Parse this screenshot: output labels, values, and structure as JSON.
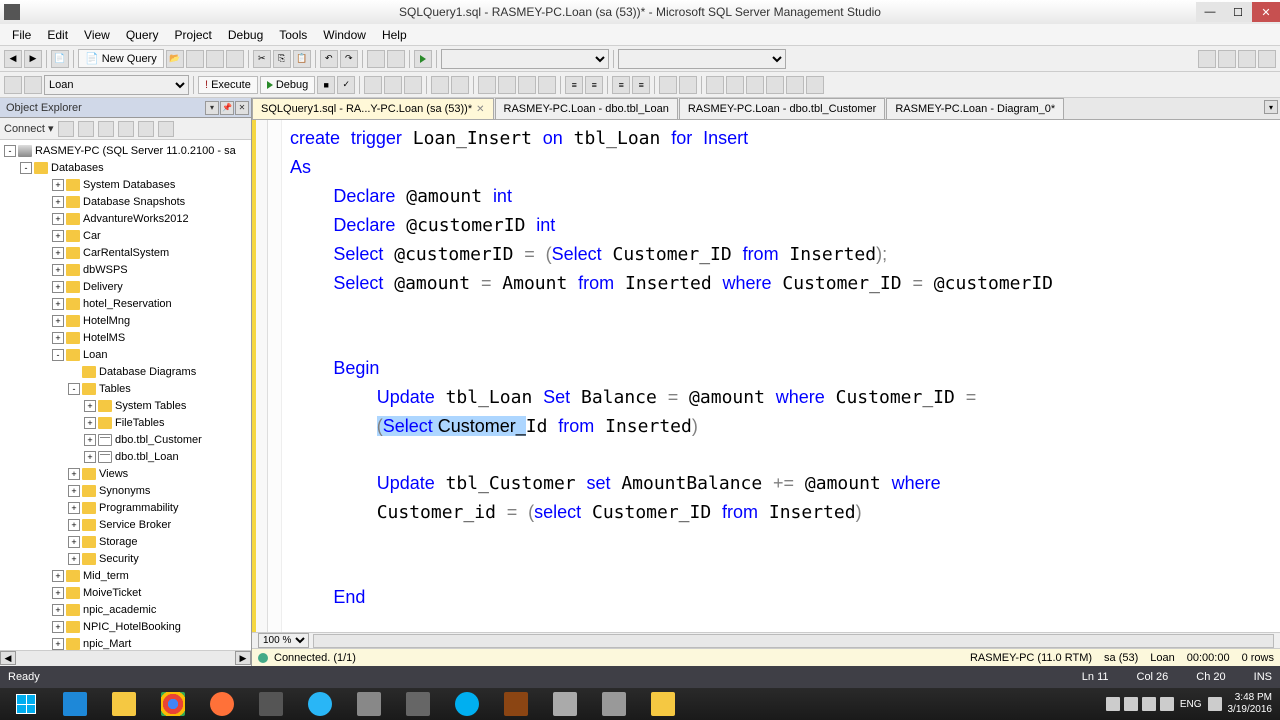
{
  "titlebar": {
    "text": "SQLQuery1.sql - RASMEY-PC.Loan (sa (53))* - Microsoft SQL Server Management Studio"
  },
  "menu": [
    "File",
    "Edit",
    "View",
    "Query",
    "Project",
    "Debug",
    "Tools",
    "Window",
    "Help"
  ],
  "toolbar": {
    "new_query": "New Query",
    "execute": "Execute",
    "debug": "Debug",
    "db_combo": "Loan"
  },
  "object_explorer": {
    "title": "Object Explorer",
    "connect": "Connect ▾",
    "server": "RASMEY-PC (SQL Server 11.0.2100 - sa",
    "databases": "Databases",
    "nodes": [
      {
        "label": "System Databases",
        "type": "folder",
        "exp": "+",
        "indent": 3
      },
      {
        "label": "Database Snapshots",
        "type": "folder",
        "exp": "+",
        "indent": 3
      },
      {
        "label": "AdvantureWorks2012",
        "type": "folder",
        "exp": "+",
        "indent": 3
      },
      {
        "label": "Car",
        "type": "folder",
        "exp": "+",
        "indent": 3
      },
      {
        "label": "CarRentalSystem",
        "type": "folder",
        "exp": "+",
        "indent": 3
      },
      {
        "label": "dbWSPS",
        "type": "folder",
        "exp": "+",
        "indent": 3
      },
      {
        "label": "Delivery",
        "type": "folder",
        "exp": "+",
        "indent": 3
      },
      {
        "label": "hotel_Reservation",
        "type": "folder",
        "exp": "+",
        "indent": 3
      },
      {
        "label": "HotelMng",
        "type": "folder",
        "exp": "+",
        "indent": 3
      },
      {
        "label": "HotelMS",
        "type": "folder",
        "exp": "+",
        "indent": 3
      },
      {
        "label": "Loan",
        "type": "folder",
        "exp": "-",
        "indent": 3
      },
      {
        "label": "Database Diagrams",
        "type": "folder",
        "exp": "",
        "indent": 4
      },
      {
        "label": "Tables",
        "type": "folder",
        "exp": "-",
        "indent": 4
      },
      {
        "label": "System Tables",
        "type": "folder",
        "exp": "+",
        "indent": 5
      },
      {
        "label": "FileTables",
        "type": "folder",
        "exp": "+",
        "indent": 5
      },
      {
        "label": "dbo.tbl_Customer",
        "type": "table",
        "exp": "+",
        "indent": 5
      },
      {
        "label": "dbo.tbl_Loan",
        "type": "table",
        "exp": "+",
        "indent": 5
      },
      {
        "label": "Views",
        "type": "folder",
        "exp": "+",
        "indent": 4
      },
      {
        "label": "Synonyms",
        "type": "folder",
        "exp": "+",
        "indent": 4
      },
      {
        "label": "Programmability",
        "type": "folder",
        "exp": "+",
        "indent": 4
      },
      {
        "label": "Service Broker",
        "type": "folder",
        "exp": "+",
        "indent": 4
      },
      {
        "label": "Storage",
        "type": "folder",
        "exp": "+",
        "indent": 4
      },
      {
        "label": "Security",
        "type": "folder",
        "exp": "+",
        "indent": 4
      },
      {
        "label": "Mid_term",
        "type": "folder",
        "exp": "+",
        "indent": 3
      },
      {
        "label": "MoiveTicket",
        "type": "folder",
        "exp": "+",
        "indent": 3
      },
      {
        "label": "npic_academic",
        "type": "folder",
        "exp": "+",
        "indent": 3
      },
      {
        "label": "NPIC_HotelBooking",
        "type": "folder",
        "exp": "+",
        "indent": 3
      },
      {
        "label": "npic_Mart",
        "type": "folder",
        "exp": "+",
        "indent": 3
      }
    ]
  },
  "tabs": [
    {
      "label": "SQLQuery1.sql - RA...Y-PC.Loan (sa (53))*",
      "active": true,
      "close": true
    },
    {
      "label": "RASMEY-PC.Loan - dbo.tbl_Loan",
      "active": false,
      "close": false
    },
    {
      "label": "RASMEY-PC.Loan - dbo.tbl_Customer",
      "active": false,
      "close": false
    },
    {
      "label": "RASMEY-PC.Loan - Diagram_0*",
      "active": false,
      "close": false
    }
  ],
  "code": {
    "l1a": "create",
    "l1b": " ",
    "l1c": "trigger",
    "l1d": " Loan_Insert ",
    "l1e": "on",
    "l1f": " tbl_Loan ",
    "l1g": "for",
    "l1h": " ",
    "l1i": "Insert",
    "l2": "As",
    "l3a": "    ",
    "l3b": "Declare",
    "l3c": " @amount ",
    "l3d": "int",
    "l4a": "    ",
    "l4b": "Declare",
    "l4c": " @customerID ",
    "l4d": "int",
    "l5a": "    ",
    "l5b": "Select",
    "l5c": " @customerID ",
    "l5d": "=",
    "l5e": " ",
    "l5f": "(",
    "l5g": "Select",
    "l5h": " Customer_ID ",
    "l5i": "from",
    "l5j": " Inserted",
    "l5k": ");",
    "l6a": "    ",
    "l6b": "Select",
    "l6c": " @amount ",
    "l6d": "=",
    "l6e": " Amount ",
    "l6f": "from",
    "l6g": " Inserted ",
    "l6h": "where",
    "l6i": " Customer_ID ",
    "l6j": "=",
    "l6k": " @customerID",
    "l8a": "    ",
    "l8b": "Begin",
    "l9a": "        ",
    "l9b": "Update",
    "l9c": " tbl_Loan ",
    "l9d": "Set",
    "l9e": " Balance ",
    "l9f": "=",
    "l9g": " @amount ",
    "l9h": "where",
    "l9i": " Customer_ID ",
    "l9j": "=",
    "l10a": "        ",
    "l10b": "(",
    "l10c": "Select",
    "l10d": " Customer_",
    "l10e": "Id ",
    "l10f": "from",
    "l10g": " Inserted",
    "l10h": ")",
    "l12a": "        ",
    "l12b": "Update",
    "l12c": " tbl_Customer ",
    "l12d": "set",
    "l12e": " AmountBalance ",
    "l12f": "+=",
    "l12g": " @amount ",
    "l12h": "where",
    "l13a": "        Customer_id ",
    "l13b": "=",
    "l13c": " ",
    "l13d": "(",
    "l13e": "select",
    "l13f": " Customer_ID ",
    "l13g": "from",
    "l13h": " Inserted",
    "l13i": ")",
    "l15a": "    ",
    "l15b": "End"
  },
  "zoom": "100 %",
  "conn_status": {
    "connected": "Connected. (1/1)",
    "server": "RASMEY-PC (11.0 RTM)",
    "user": "sa (53)",
    "db": "Loan",
    "time": "00:00:00",
    "rows": "0 rows"
  },
  "statusbar": {
    "ready": "Ready",
    "ln": "Ln 11",
    "col": "Col 26",
    "ch": "Ch 20",
    "ins": "INS"
  },
  "taskbar": {
    "tray_text": "ENG",
    "time": "3:48 PM",
    "date": "3/19/2016"
  }
}
